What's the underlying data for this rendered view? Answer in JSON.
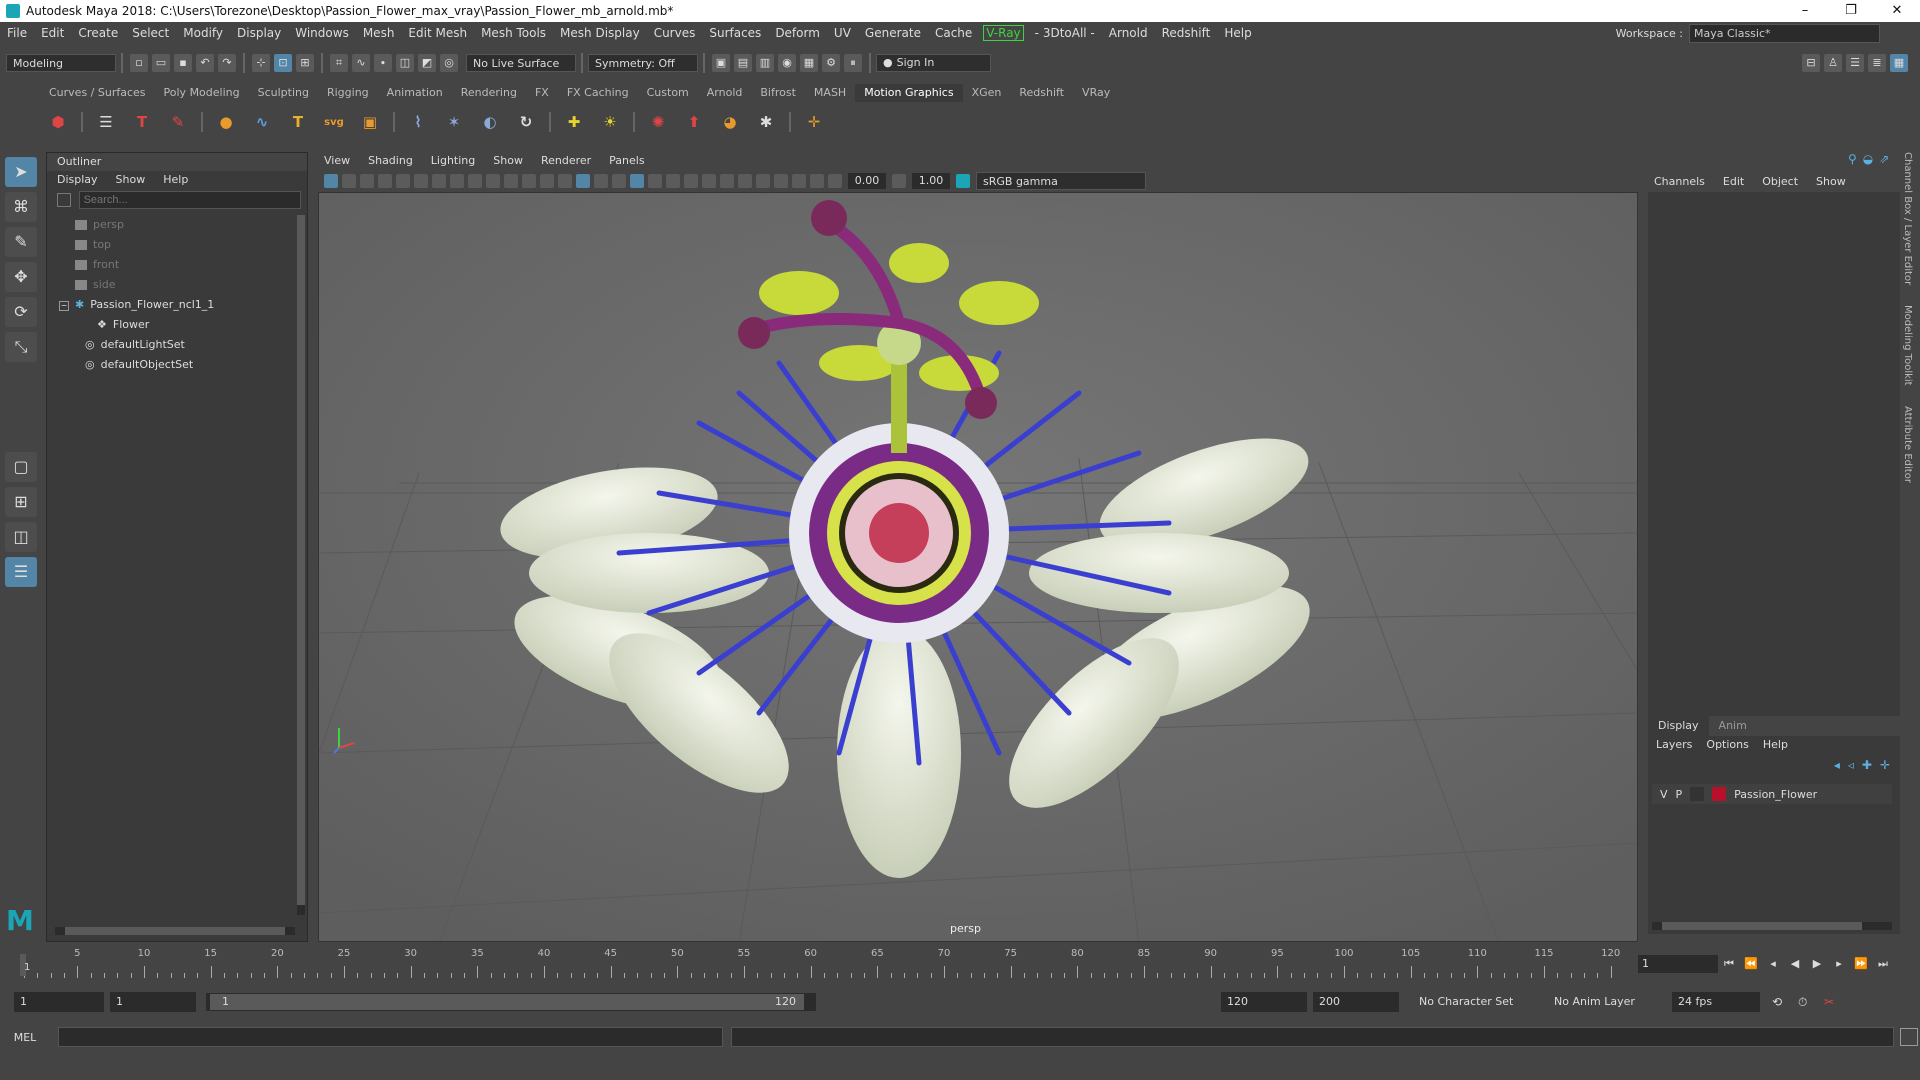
{
  "window": {
    "title": "Autodesk Maya 2018: C:\\Users\\Torezone\\Desktop\\Passion_Flower_max_vray\\Passion_Flower_mb_arnold.mb*",
    "minimize": "–",
    "restore": "❐",
    "close": "✕"
  },
  "menubar": {
    "items": [
      "File",
      "Edit",
      "Create",
      "Select",
      "Modify",
      "Display",
      "Windows",
      "Mesh",
      "Edit Mesh",
      "Mesh Tools",
      "Mesh Display",
      "Curves",
      "Surfaces",
      "Deform",
      "UV",
      "Generate",
      "Cache"
    ],
    "vray": "V-Ray",
    "items_after": [
      "- 3DtoAll -",
      "Arnold",
      "Redshift",
      "Help"
    ],
    "workspace_label": "Workspace :",
    "workspace_value": "Maya Classic*"
  },
  "statusline": {
    "mode": "Modeling",
    "live_surface": "No Live Surface",
    "symmetry": "Symmetry: Off",
    "sign_in": "Sign In"
  },
  "shelf": {
    "tabs": [
      "Curves / Surfaces",
      "Poly Modeling",
      "Sculpting",
      "Rigging",
      "Animation",
      "Rendering",
      "FX",
      "FX Caching",
      "Custom",
      "Arnold",
      "Bifrost",
      "MASH",
      "Motion Graphics",
      "XGen",
      "Redshift",
      "VRay"
    ],
    "active_tab": "Motion Graphics"
  },
  "outliner": {
    "title": "Outliner",
    "menu": [
      "Display",
      "Show",
      "Help"
    ],
    "search_placeholder": "Search...",
    "items": [
      {
        "label": "persp",
        "dim": true
      },
      {
        "label": "top",
        "dim": true
      },
      {
        "label": "front",
        "dim": true
      },
      {
        "label": "side",
        "dim": true
      },
      {
        "label": "Passion_Flower_ncl1_1",
        "dim": false
      },
      {
        "label": "Flower",
        "dim": false
      },
      {
        "label": "defaultLightSet",
        "dim": false
      },
      {
        "label": "defaultObjectSet",
        "dim": false
      }
    ]
  },
  "viewport": {
    "menu": [
      "View",
      "Shading",
      "Lighting",
      "Show",
      "Renderer",
      "Panels"
    ],
    "exposure": "0.00",
    "gamma": "1.00",
    "color_space": "sRGB gamma",
    "camera_label": "persp"
  },
  "channelbox": {
    "menu": [
      "Channels",
      "Edit",
      "Object",
      "Show"
    ]
  },
  "layers": {
    "tabs": [
      "Display",
      "Anim"
    ],
    "menu": [
      "Layers",
      "Options",
      "Help"
    ],
    "row": {
      "v": "V",
      "p": "P",
      "name": "Passion_Flower",
      "color": "#b8102b"
    }
  },
  "sidetabs": [
    "Channel Box / Layer Editor",
    "Modeling Toolkit",
    "Attribute Editor"
  ],
  "timeline": {
    "tick_labels": [
      "5",
      "10",
      "15",
      "20",
      "25",
      "30",
      "35",
      "40",
      "45",
      "50",
      "55",
      "60",
      "65",
      "70",
      "75",
      "80",
      "85",
      "90",
      "95",
      "100",
      "105",
      "110",
      "115",
      "120"
    ],
    "current_frame": "1",
    "start_marker": "1"
  },
  "rangebar": {
    "start": "1",
    "anim_start": "1",
    "range_start": "1",
    "range_end": "120",
    "end": "120",
    "anim_end": "200",
    "character_set": "No Character Set",
    "anim_layer": "No Anim Layer",
    "fps": "24 fps"
  },
  "cmdline": {
    "label": "MEL"
  },
  "colors": {
    "accent": "#5285a6",
    "vray": "#3fd43f",
    "layer": "#b8102b"
  }
}
